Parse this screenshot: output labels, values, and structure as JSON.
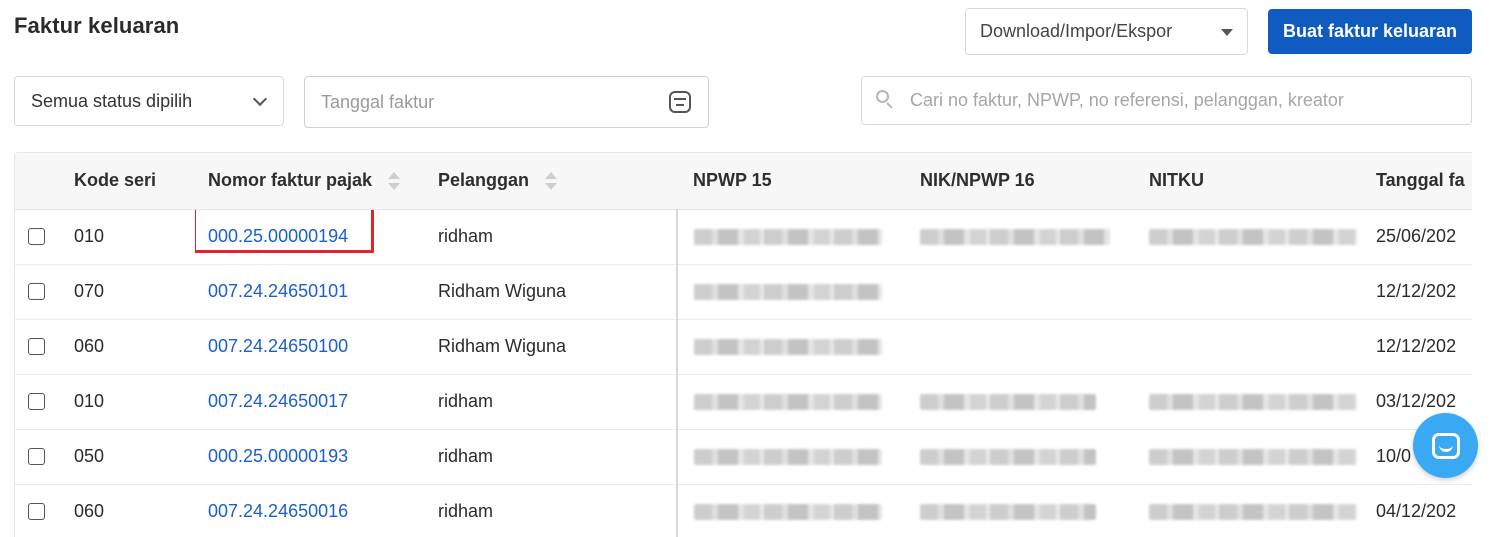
{
  "header": {
    "title": "Faktur keluaran",
    "download_label": "Download/Impor/Ekspor",
    "create_label": "Buat faktur keluaran"
  },
  "filters": {
    "status_label": "Semua status dipilih",
    "date_placeholder": "Tanggal faktur",
    "search_placeholder": "Cari no faktur, NPWP, no referensi, pelanggan, kreator"
  },
  "table": {
    "columns": {
      "kode_seri": "Kode seri",
      "nomor_faktur": "Nomor faktur pajak",
      "pelanggan": "Pelanggan",
      "npwp15": "NPWP 15",
      "nik_npwp16": "NIK/NPWP 16",
      "nitku": "NITKU",
      "tanggal": "Tanggal fa"
    },
    "rows": [
      {
        "kode": "010",
        "nomor": "000.25.00000194",
        "pelanggan": "ridham",
        "tanggal": "25/06/202",
        "has_nik": true
      },
      {
        "kode": "070",
        "nomor": "007.24.24650101",
        "pelanggan": "Ridham Wiguna",
        "tanggal": "12/12/202",
        "has_nik": false
      },
      {
        "kode": "060",
        "nomor": "007.24.24650100",
        "pelanggan": "Ridham Wiguna",
        "tanggal": "12/12/202",
        "has_nik": false
      },
      {
        "kode": "010",
        "nomor": "007.24.24650017",
        "pelanggan": "ridham",
        "tanggal": "03/12/202",
        "has_nik": true
      },
      {
        "kode": "050",
        "nomor": "000.25.00000193",
        "pelanggan": "ridham",
        "tanggal": "10/0",
        "has_nik": true
      },
      {
        "kode": "060",
        "nomor": "007.24.24650016",
        "pelanggan": "ridham",
        "tanggal": "04/12/202",
        "has_nik": true
      }
    ]
  },
  "colors": {
    "primary": "#0f5bc0",
    "link": "#1a5fd1",
    "highlight": "#e0242a",
    "chat": "#3aa9f4"
  },
  "icons": {
    "download_caret": "caret-down-icon",
    "status_chevron": "chevron-down-icon",
    "date": "calendar-icon",
    "search": "search-icon",
    "sort": "sort-icon",
    "chat": "chat-icon"
  }
}
